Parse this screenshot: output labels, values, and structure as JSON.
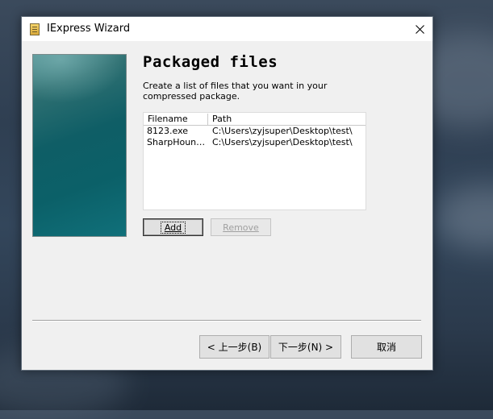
{
  "window": {
    "title": "IExpress Wizard",
    "icon": "iexpress-app-icon",
    "close_icon": "close-icon"
  },
  "page": {
    "heading": "Packaged files",
    "description": "Create a list of files that you want in your compressed package."
  },
  "file_list": {
    "columns": [
      "Filename",
      "Path"
    ],
    "rows": [
      {
        "filename": "8123.exe",
        "path": "C:\\Users\\zyjsuper\\Desktop\\test\\"
      },
      {
        "filename": "SharpHound....",
        "path": "C:\\Users\\zyjsuper\\Desktop\\test\\"
      }
    ]
  },
  "buttons": {
    "add": "Add",
    "remove": "Remove",
    "back": "< 上一步(B)",
    "next": "下一步(N) >",
    "cancel": "取消"
  },
  "colors": {
    "dialog_bg": "#f0f0f0",
    "titlebar_bg": "#ffffff",
    "side_image_teal": "#0f5e66",
    "disabled_text": "#a0a0a0"
  }
}
